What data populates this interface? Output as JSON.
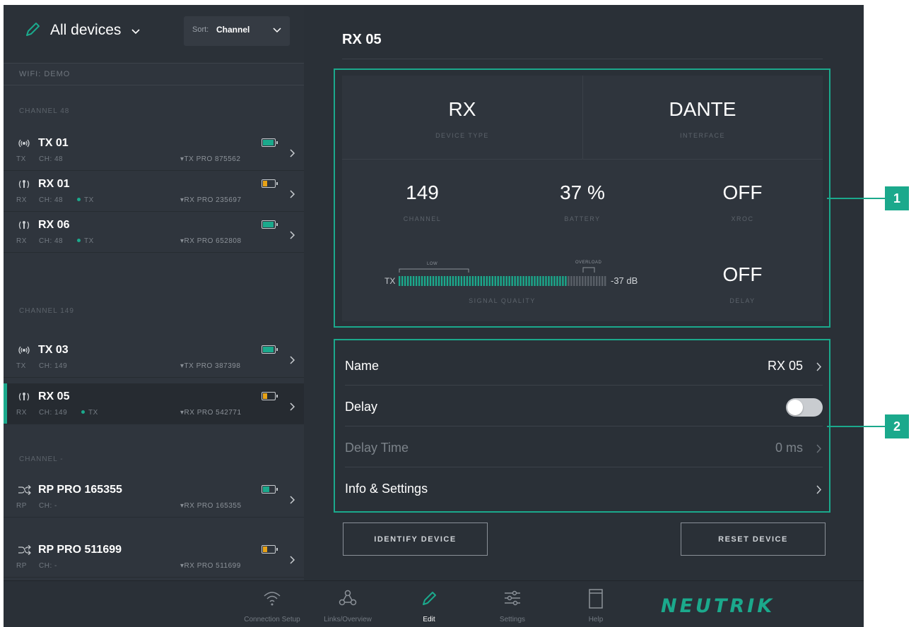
{
  "sidebar": {
    "title": "All devices",
    "sort_label": "Sort:",
    "sort_value": "Channel",
    "wifi": "WIFI: DEMO",
    "groups": [
      "CHANNEL 48",
      "CHANNEL 149",
      "CHANNEL -"
    ],
    "devices": [
      {
        "name": "TX 01",
        "type": "TX",
        "ch": "CH: 48",
        "link": "",
        "net": "TX PRO 875562",
        "battery": "full",
        "icon": "transmitter-icon"
      },
      {
        "name": "RX 01",
        "type": "RX",
        "ch": "CH: 48",
        "link": "TX",
        "net": "RX PRO 235697",
        "battery": "low",
        "icon": "receiver-icon"
      },
      {
        "name": "RX 06",
        "type": "RX",
        "ch": "CH: 48",
        "link": "TX",
        "net": "RX PRO 652808",
        "battery": "full",
        "icon": "receiver-icon"
      },
      {
        "name": "TX 03",
        "type": "TX",
        "ch": "CH: 149",
        "link": "",
        "net": "TX PRO 387398",
        "battery": "full",
        "icon": "transmitter-icon"
      },
      {
        "name": "RX 05",
        "type": "RX",
        "ch": "CH: 149",
        "link": "TX",
        "net": "RX PRO 542771",
        "battery": "low",
        "icon": "receiver-icon",
        "selected": true
      },
      {
        "name": "RP PRO 165355",
        "type": "RP",
        "ch": "CH: -",
        "link": "",
        "net": "RX PRO 165355",
        "battery": "half",
        "icon": "repeater-icon"
      },
      {
        "name": "RP PRO 511699",
        "type": "RP",
        "ch": "CH: -",
        "link": "",
        "net": "RX PRO 511699",
        "battery": "low",
        "icon": "repeater-icon"
      }
    ]
  },
  "main": {
    "title": "RX 05",
    "device_type": {
      "value": "RX",
      "label": "DEVICE TYPE"
    },
    "interface": {
      "value": "DANTE",
      "label": "INTERFACE"
    },
    "channel": {
      "value": "149",
      "label": "CHANNEL"
    },
    "battery": {
      "value": "37 %",
      "label": "BATTERY"
    },
    "xroc": {
      "value": "OFF",
      "label": "XROC"
    },
    "signal": {
      "prefix": "TX",
      "low_label": "LOW",
      "overload_label": "OVERLOAD",
      "db": "-37 dB",
      "label": "SIGNAL QUALITY",
      "level": 0.8
    },
    "delay_stat": {
      "value": "OFF",
      "label": "DELAY"
    },
    "rows": {
      "name": {
        "label": "Name",
        "value": "RX 05"
      },
      "delay": {
        "label": "Delay",
        "enabled": false
      },
      "delay_time": {
        "label": "Delay Time",
        "value": "0 ms"
      },
      "info": {
        "label": "Info & Settings"
      }
    },
    "buttons": {
      "identify": "IDENTIFY DEVICE",
      "reset": "RESET DEVICE"
    }
  },
  "footer": {
    "nav": [
      "Connection Setup",
      "Links/Overview",
      "Edit",
      "Settings",
      "Help"
    ],
    "active": "Edit",
    "logo": "NEUTRIK"
  },
  "callouts": [
    "1",
    "2"
  ],
  "colors": {
    "accent": "#1ba98c",
    "battery_low": "#e8a317",
    "background": "#2a3037"
  }
}
